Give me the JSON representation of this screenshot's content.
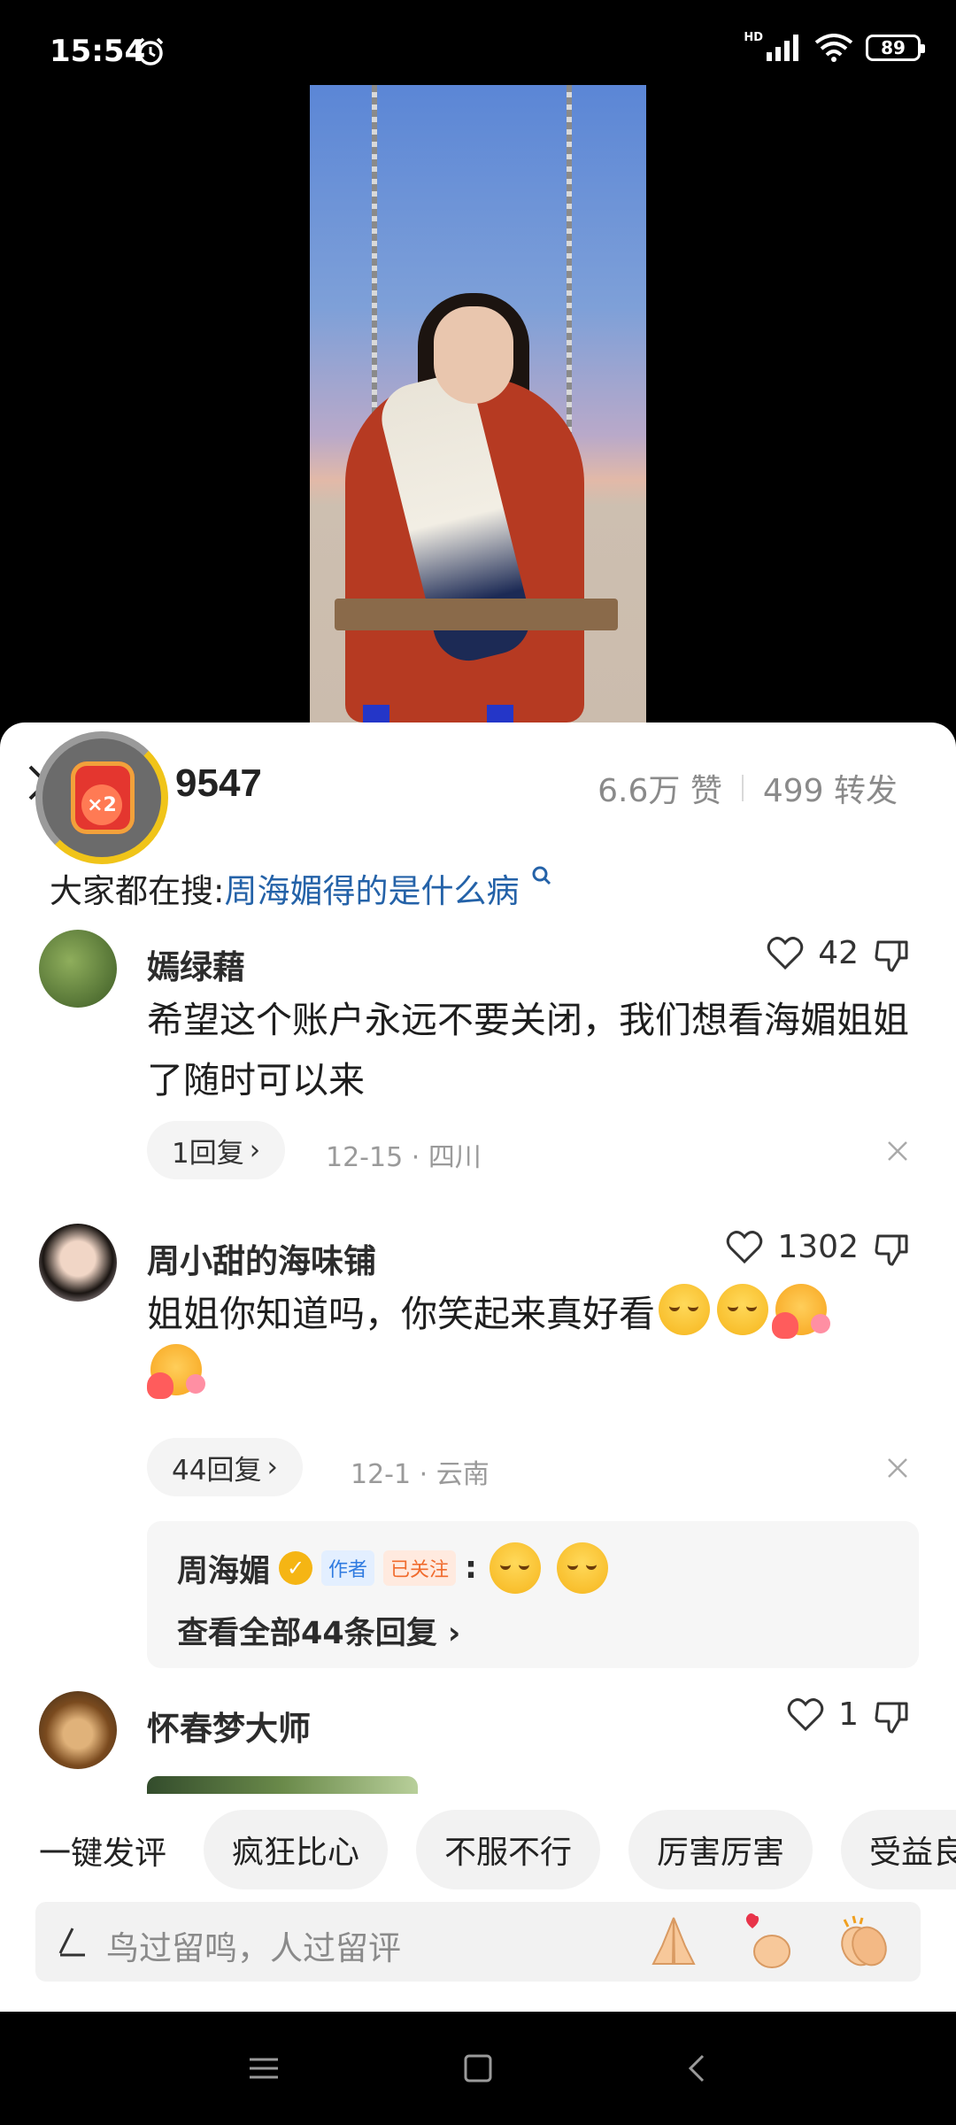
{
  "status_bar": {
    "time": "15:54",
    "network": "HD",
    "battery": "89"
  },
  "comments_header": {
    "title_partial": "论",
    "count": "9547",
    "likes": "6.6万 赞",
    "reposts": "499 转发",
    "reward_badge": "×2"
  },
  "search": {
    "prefix": "大家都在搜:",
    "keyword": "周海媚得的是什么病"
  },
  "comments": [
    {
      "name": "嫣绿藉",
      "likes": "42",
      "text": "希望这个账户永远不要关闭，我们想看海媚姐姐了随时可以来",
      "reply_count": "1回复",
      "date": "12-15",
      "location": "四川"
    },
    {
      "name": "周小甜的海味铺",
      "likes": "1302",
      "text": "姐姐你知道吗，你笑起来真好看",
      "reply_count": "44回复",
      "date": "12-1",
      "location": "云南",
      "author_reply": {
        "name": "周海媚",
        "author_tag": "作者",
        "follow_tag": "已关注",
        "colon": ":",
        "view_all": "查看全部44条回复"
      }
    },
    {
      "name": "怀春梦大师",
      "likes": "1"
    }
  ],
  "quick_comments": {
    "label": "一键发评",
    "chips": [
      "疯狂比心",
      "不服不行",
      "厉害厉害",
      "受益良"
    ]
  },
  "input": {
    "placeholder": "鸟过留鸣，人过留评"
  },
  "colors": {
    "link_blue": "#2462a8",
    "author_tag": "#2f7be0",
    "follow_tag": "#f06b2d"
  }
}
